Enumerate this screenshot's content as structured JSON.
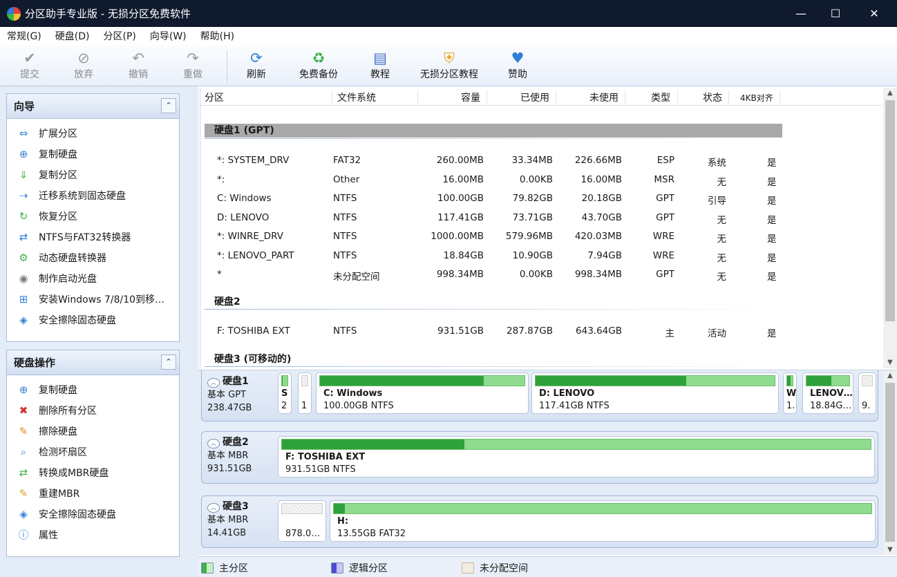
{
  "window": {
    "title": "分区助手专业版 - 无损分区免费软件",
    "minimize": "—",
    "maximize": "☐",
    "close": "✕"
  },
  "menu": [
    "常规(G)",
    "硬盘(D)",
    "分区(P)",
    "向导(W)",
    "帮助(H)"
  ],
  "toolbar": {
    "submit": "提交",
    "discard": "放弃",
    "undo": "撤销",
    "redo": "重做",
    "refresh": "刷新",
    "backup": "免费备份",
    "tutorial": "教程",
    "lossless_tutorial": "无损分区教程",
    "donate": "赞助"
  },
  "wizard": {
    "title": "向导",
    "items": [
      "扩展分区",
      "复制硬盘",
      "复制分区",
      "迁移系统到固态硬盘",
      "恢复分区",
      "NTFS与FAT32转换器",
      "动态硬盘转换器",
      "制作启动光盘",
      "安装Windows 7/8/10到移…",
      "安全擦除固态硬盘"
    ]
  },
  "disk_ops": {
    "title": "硬盘操作",
    "items": [
      "复制硬盘",
      "删除所有分区",
      "擦除硬盘",
      "检测坏扇区",
      "转换成MBR硬盘",
      "重建MBR",
      "安全擦除固态硬盘",
      "属性"
    ]
  },
  "table": {
    "headers": [
      "分区",
      "文件系统",
      "容量",
      "已使用",
      "未使用",
      "类型",
      "状态",
      "4KB对齐"
    ],
    "disk1_title": "硬盘1 (GPT)",
    "disk1_rows": [
      [
        "*: SYSTEM_DRV",
        "FAT32",
        "260.00MB",
        "33.34MB",
        "226.66MB",
        "ESP",
        "系统",
        "是"
      ],
      [
        "*:",
        "Other",
        "16.00MB",
        "0.00KB",
        "16.00MB",
        "MSR",
        "无",
        "是"
      ],
      [
        "C: Windows",
        "NTFS",
        "100.00GB",
        "79.82GB",
        "20.18GB",
        "GPT",
        "引导",
        "是"
      ],
      [
        "D: LENOVO",
        "NTFS",
        "117.41GB",
        "73.71GB",
        "43.70GB",
        "GPT",
        "无",
        "是"
      ],
      [
        "*: WINRE_DRV",
        "NTFS",
        "1000.00MB",
        "579.96MB",
        "420.03MB",
        "WRE",
        "无",
        "是"
      ],
      [
        "*: LENOVO_PART",
        "NTFS",
        "18.84GB",
        "10.90GB",
        "7.94GB",
        "WRE",
        "无",
        "是"
      ],
      [
        "*",
        "未分配空间",
        "998.34MB",
        "0.00KB",
        "998.34MB",
        "GPT",
        "无",
        "是"
      ]
    ],
    "disk2_title": "硬盘2",
    "disk2_rows": [
      [
        "F: TOSHIBA EXT",
        "NTFS",
        "931.51GB",
        "287.87GB",
        "643.64GB",
        "主",
        "活动",
        "是"
      ]
    ],
    "disk3_title": "硬盘3 (可移动的)"
  },
  "map": {
    "disk1": {
      "name": "硬盘1",
      "type": "基本 GPT",
      "size": "238.47GB",
      "parts": [
        {
          "label": "S",
          "sub": "2",
          "used": 0.13
        },
        {
          "label": "",
          "sub": "1",
          "used": 0.0
        },
        {
          "label": "C: Windows",
          "sub": "100.00GB NTFS",
          "used": 0.8
        },
        {
          "label": "D: LENOVO",
          "sub": "117.41GB NTFS",
          "used": 0.63
        },
        {
          "label": "W",
          "sub": "1.",
          "used": 0.58
        },
        {
          "label": "LENOV…",
          "sub": "18.84G…",
          "used": 0.58
        },
        {
          "label": "",
          "sub": "9.",
          "used": 0.0
        }
      ]
    },
    "disk2": {
      "name": "硬盘2",
      "type": "基本 MBR",
      "size": "931.51GB",
      "parts": [
        {
          "label": "F: TOSHIBA EXT",
          "sub": "931.51GB NTFS",
          "used": 0.31
        }
      ]
    },
    "disk3": {
      "name": "硬盘3",
      "type": "基本 MBR",
      "size": "14.41GB",
      "parts": [
        {
          "label": "",
          "sub": "878.0…",
          "used": 0.0
        },
        {
          "label": "H:",
          "sub": "13.55GB FAT32",
          "used": 0.02
        }
      ]
    }
  },
  "legend": {
    "primary": "主分区",
    "logical": "逻辑分区",
    "unallocated": "未分配空间"
  },
  "colors": {
    "primary": "#3bb34a",
    "logical": "#4a4ad6",
    "unallocated": "#efe6d6",
    "titlebar": "#101a2e"
  }
}
